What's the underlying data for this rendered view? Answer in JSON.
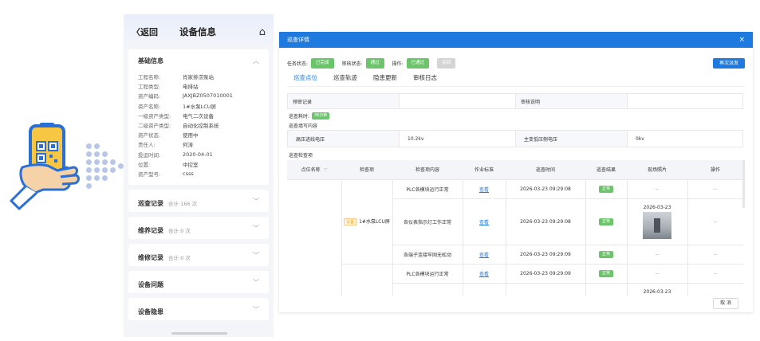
{
  "mobile": {
    "back": "〈返回",
    "title": "设备信息",
    "basic": {
      "title": "基础信息",
      "rows": [
        {
          "k": "工程名称:",
          "v": "肖家排涝泵站"
        },
        {
          "k": "工程类型:",
          "v": "电排站"
        },
        {
          "k": "资产编码:",
          "v": "JAXJBZ0507010001"
        },
        {
          "k": "资产名称:",
          "v": "1#水泵LCU屏"
        },
        {
          "k": "一级资产类型:",
          "v": "电气二次设备"
        },
        {
          "k": "二级资产类型:",
          "v": "自动化控制系统"
        },
        {
          "k": "资产状态:",
          "v": "使用中"
        },
        {
          "k": "责任人:",
          "v": "何涛"
        },
        {
          "k": "投运时间:",
          "v": "2020-04-01"
        },
        {
          "k": "位置:",
          "v": "中控室"
        },
        {
          "k": "资产型号:",
          "v": "csss"
        }
      ]
    },
    "sections": [
      {
        "title": "巡查记录",
        "sub": "合计:166 次"
      },
      {
        "title": "维养记录",
        "sub": "合计:0 次"
      },
      {
        "title": "维修记录",
        "sub": "合计:0 次"
      },
      {
        "title": "设备问题",
        "sub": ""
      },
      {
        "title": "设备隐患",
        "sub": ""
      }
    ]
  },
  "dialog": {
    "title": "巡查详情",
    "close": "×",
    "status": {
      "task_label": "任务状态:",
      "task_value": "已完成",
      "audit_label": "审核状态:",
      "audit_value": "通过",
      "op_label": "操作:",
      "op_approve": "已通过",
      "op_reject": "驳回"
    },
    "resubmit": "再次派发",
    "tabs": [
      "巡查点位",
      "巡查轨迹",
      "隐患更新",
      "审核日志"
    ],
    "record": {
      "k1": "预审记录",
      "v1": "",
      "k2": "审核说明",
      "v2": ""
    },
    "time_label": "巡查耗时:",
    "time_value": "36分钟",
    "fill_label": "巡查填写内容",
    "voltage": {
      "k1": "高压进线电压",
      "v1": "10.2kv",
      "k2": "主变低压侧电压",
      "v2": "0kv"
    },
    "check_label": "巡查检查项",
    "grid": {
      "headers": [
        "点位名称",
        "检查项",
        "检查项内容",
        "作业标准",
        "巡查时间",
        "巡查结果",
        "现场照片",
        "操作"
      ],
      "object_tag": "设备",
      "object_name": "1#水泵LCU屏",
      "rows": [
        {
          "content": "PLC各模块运行正常",
          "std": "查看",
          "time": "2026-03-23 09:29:08",
          "result": "正常",
          "photo": "--",
          "op": "--"
        },
        {
          "content": "各仪表指示灯工作正常",
          "std": "查看",
          "time": "2026-03-23 09:29:08",
          "result": "正常",
          "photo_date": "2026-03-23",
          "op": "--"
        },
        {
          "content": "各端子连接牢固无松动",
          "std": "查看",
          "time": "2026-03-23 09:29:09",
          "result": "正常",
          "photo": "--",
          "op": "--"
        },
        {
          "content": "PLC各模块运行正常",
          "std": "查看",
          "time": "2026-03-23 09:29:09",
          "result": "正常",
          "photo": "--",
          "op": "--"
        },
        {
          "photo_date": "2026-03-23"
        }
      ]
    },
    "cancel": "取 消"
  }
}
